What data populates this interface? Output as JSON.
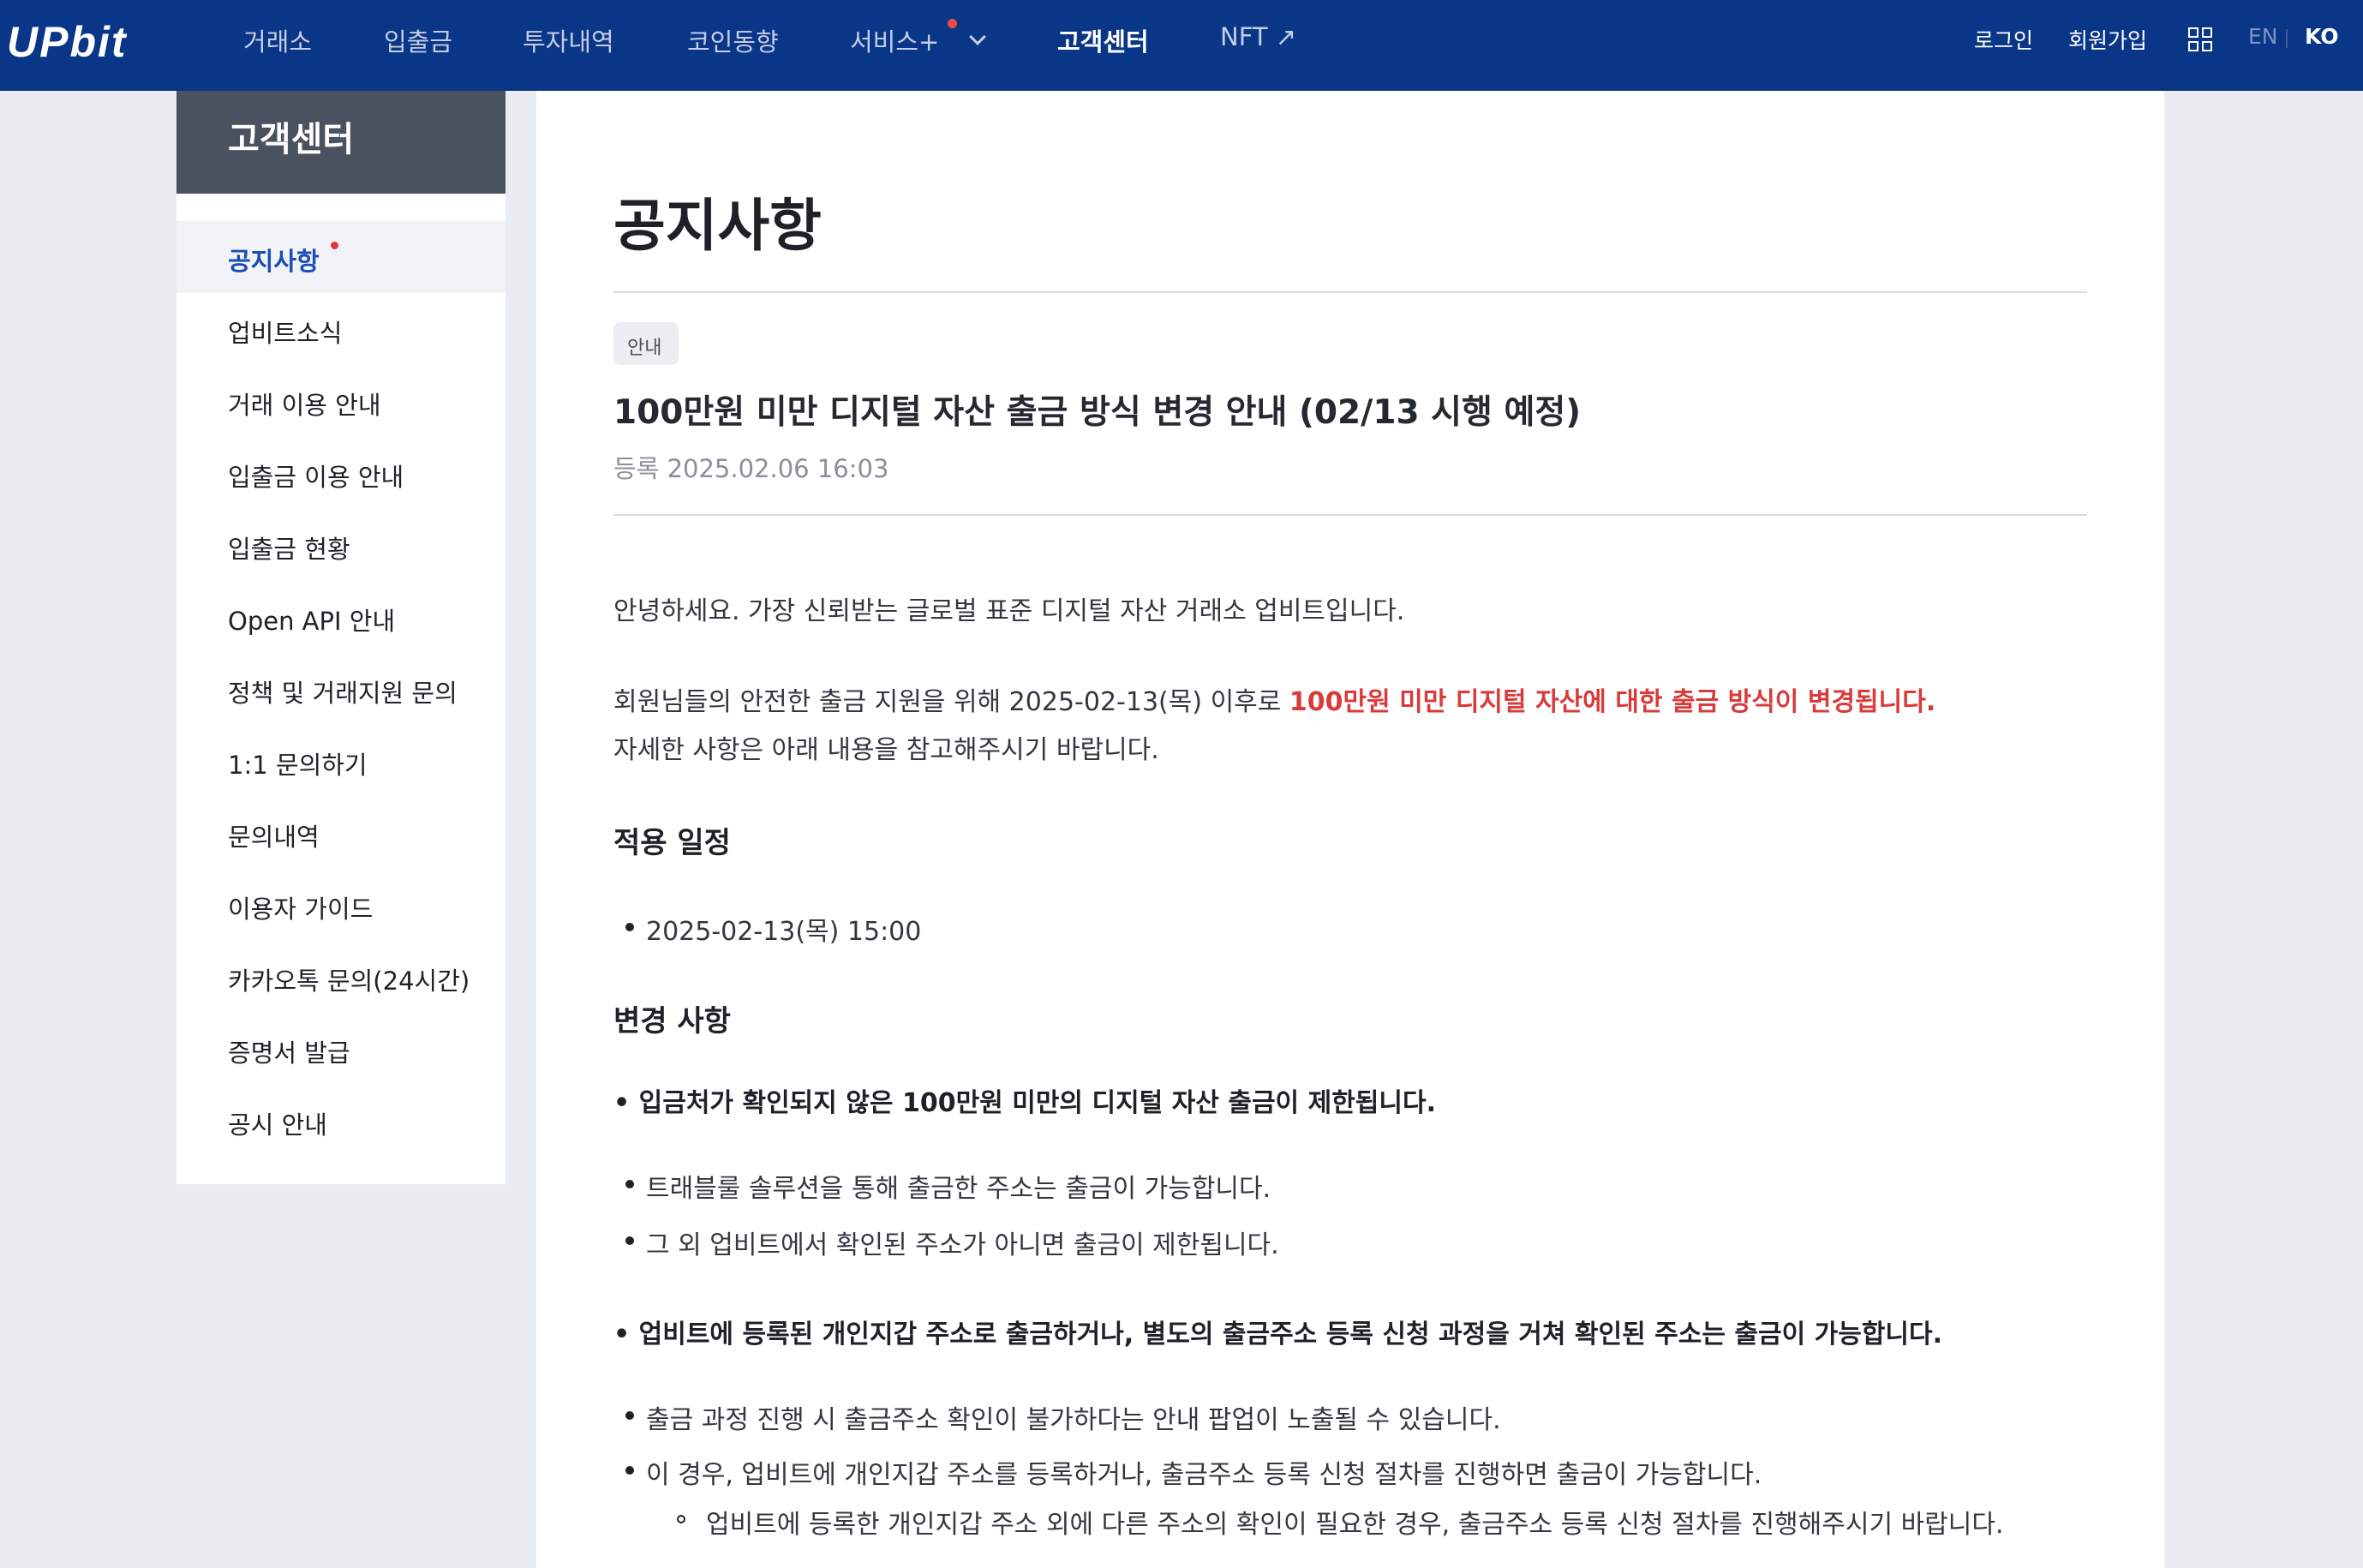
{
  "header": {
    "logo": "UPbit",
    "nav": [
      "거래소",
      "입출금",
      "투자내역",
      "코인동향",
      "서비스+",
      "고객센터",
      "NFT ↗"
    ],
    "login": "로그인",
    "signup": "회원가입",
    "lang_en": "EN",
    "lang_ko": "KO",
    "colors": {
      "bar": "#093687",
      "active": "#ffffff",
      "badge_dot": "#f34747"
    }
  },
  "sidebar": {
    "title": "고객센터",
    "items": [
      "공지사항",
      "업비트소식",
      "거래 이용 안내",
      "입출금 이용 안내",
      "입출금 현황",
      "Open API 안내",
      "정책 및 거래지원 문의",
      "1:1 문의하기",
      "문의내역",
      "이용자 가이드",
      "카카오톡 문의(24시간)",
      "증명서 발급",
      "공시 안내"
    ],
    "active_index": 0
  },
  "main": {
    "page_title": "공지사항",
    "badge": "안내",
    "post_title": "100만원 미만 디지털 자산 출금 방식 변경 안내 (02/13 시행 예정)",
    "post_date": "등록 2025.02.06 16:03",
    "intro": "안녕하세요. 가장 신뢰받는 글로벌 표준 디지털 자산 거래소 업비트입니다.",
    "line2_prefix": "회원님들의 안전한 출금 지원을 위해 2025-02-13(목) 이후로 ",
    "line2_highlight": "100만원 미만 디지털 자산에 대한 출금 방식이 변경됩니다.",
    "line3": "자세한 사항은 아래 내용을 참고해주시기 바랍니다.",
    "section1_title": "적용 일정",
    "section1_bullet": "2025-02-13(목) 15:00",
    "section2_title": "변경 사항",
    "point1": "• 입금처가 확인되지 않은 100만원 미만의 디지털 자산 출금이 제한됩니다.",
    "point1_bullets": [
      "트래블룰 솔루션을 통해 출금한 주소는 출금이 가능합니다.",
      "그 외 업비트에서 확인된 주소가 아니면 출금이 제한됩니다."
    ],
    "point2": "• 업비트에 등록된 개인지갑 주소로 출금하거나, 별도의 출금주소 등록 신청 과정을 거쳐 확인된 주소는 출금이 가능합니다.",
    "point2_bullets": [
      "출금 과정 진행 시 출금주소 확인이 불가하다는 안내 팝업이 노출될 수 있습니다.",
      "이 경우, 업비트에 개인지갑 주소를 등록하거나, 출금주소 등록 신청 절차를 진행하면 출금이 가능합니다."
    ],
    "point2_sub": "업비트에 등록한 개인지갑 주소 외에 다른 주소의 확인이 필요한 경우, 출금주소 등록 신청 절차를 진행해주시기 바랍니다.",
    "highlight_color": "#d93b3b"
  }
}
